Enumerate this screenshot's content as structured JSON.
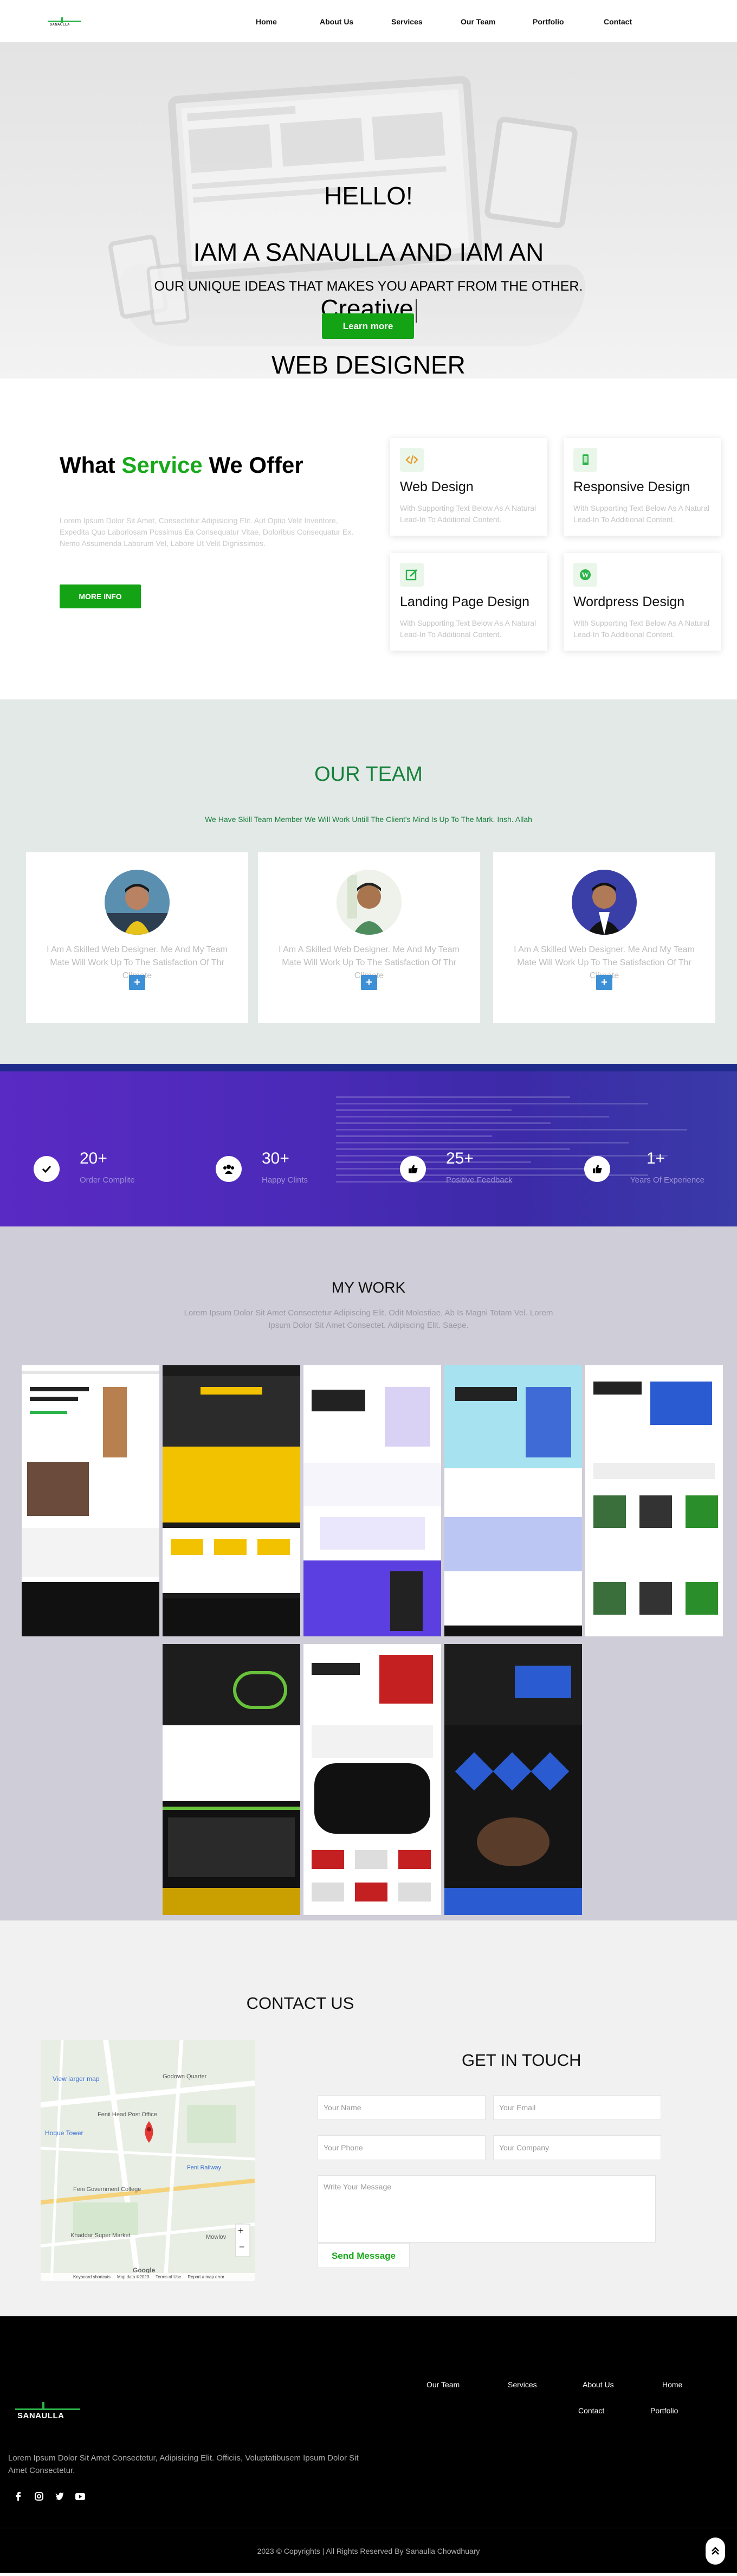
{
  "brand": {
    "name": "SANAULLA"
  },
  "nav": {
    "items": [
      "Home",
      "About Us",
      "Services",
      "Our Team",
      "Portfolio",
      "Contact"
    ]
  },
  "hero": {
    "line1": "HELLO!",
    "line2": "IAM A SANAULLA   AND IAM AN",
    "line3": "Creative",
    "line4": "WEB DESIGNER",
    "sub": "OUR UNIQUE IDEAS THAT MAKES YOU APART FROM THE OTHER.",
    "cta": "Learn more"
  },
  "services": {
    "title_a": "What ",
    "title_b": "Service",
    "title_c": " We Offer",
    "desc": "Lorem Ipsum Dolor Sit Amet, Consectetur Adipisicing Elit. Aut Optio Velit Inventore, Expedita Quo Laboriosam Possimus Ea Consequatur Vitae, Doloribus Consequatur Ex. Nemo Assumenda Laborum Vel, Labore Ut Velit Dignissimos.",
    "button": "MORE INFO",
    "cards": [
      {
        "title": "Web Design",
        "text": "With Supporting Text Below As A Natural Lead-In To Additional Content.",
        "icon": "code-icon"
      },
      {
        "title": "Responsive Design",
        "text": "With Supporting Text Below As A Natural Lead-In To Additional Content.",
        "icon": "mobile-icon"
      },
      {
        "title": "Landing Page Design",
        "text": "With Supporting Text Below As A Natural Lead-In To Additional Content.",
        "icon": "edit-icon"
      },
      {
        "title": "Wordpress Design",
        "text": "With Supporting Text Below As A Natural Lead-In To Additional Content.",
        "icon": "wordpress-icon"
      }
    ]
  },
  "team": {
    "title": "OUR TEAM",
    "sub": "We Have Skill Team Member We Will Work Untill The Client's Mind Is Up To The Mark. Insh. Allah",
    "members": [
      {
        "text": "I Am A Skilled Web Designer. Me And My Team Mate Will Work Up To The Satisfaction Of Thr Climate",
        "plus": "+"
      },
      {
        "text": "I Am A Skilled Web Designer. Me And My Team Mate Will Work Up To The Satisfaction Of Thr Climate",
        "plus": "+"
      },
      {
        "text": "I Am A Skilled Web Designer. Me And My Team Mate Will Work Up To The Satisfaction Of Thr Climate",
        "plus": "+"
      }
    ]
  },
  "stats": [
    {
      "num": "20+",
      "label": "Order Complite",
      "icon": "check-icon"
    },
    {
      "num": "30+",
      "label": "Happy Clints",
      "icon": "users-icon"
    },
    {
      "num": "25+",
      "label": "Positive Feedback",
      "icon": "thumbs-up-icon"
    },
    {
      "num": "1+",
      "label": "Years Of Experience",
      "icon": "thumbs-up-icon"
    }
  ],
  "work": {
    "title": "MY WORK",
    "sub": "Lorem Ipsum Dolor Sit Amet Consectetur Adipiscing Elit. Odit Molestiae, Ab Is Magni Totam Vel. Lorem Ipsum Dolor Sit Amet Consectet. Adipiscing Elit. Saepe."
  },
  "contact": {
    "title": "CONTACT US",
    "get_in_touch": "GET IN TOUCH",
    "name_ph": "Your Name",
    "email_ph": "Your Email",
    "phone_ph": "Your Phone",
    "company_ph": "Your Company",
    "message_ph": "Write Your Message",
    "send": "Send Message",
    "map": {
      "view_larger": "View larger map",
      "places": [
        "Godown Quarter",
        "Fenii Head Post Office",
        "Hoque Tower",
        "Feni Government College",
        "Feni Railway",
        "Mowlov",
        "Khaddar Super Market"
      ],
      "keyboard": "Keyboard shortcuts",
      "mapdata": "Map data ©2023",
      "terms": "Terms of Use",
      "report": "Report a map error",
      "google": "Google"
    }
  },
  "footer": {
    "links_row1": [
      "Our Team",
      "Services",
      "About Us",
      "Home"
    ],
    "links_row2": [
      "Contact",
      "Portfolio"
    ],
    "desc": "Lorem Ipsum Dolor Sit Amet Consectetur, Adipisicing Elit. Officiis, Voluptatibusem Ipsum Dolor Sit Amet Consectetur.",
    "copyright": "2023 © Copyrights | All Rights Reserved By Sanaulla Chowdhuary",
    "social": [
      "facebook-icon",
      "instagram-icon",
      "twitter-icon",
      "youtube-icon"
    ]
  },
  "colors": {
    "accent": "#13a315",
    "team_green": "#15813b",
    "stats_purple": "#4b2ab8",
    "plus_blue": "#3d8fd6"
  }
}
